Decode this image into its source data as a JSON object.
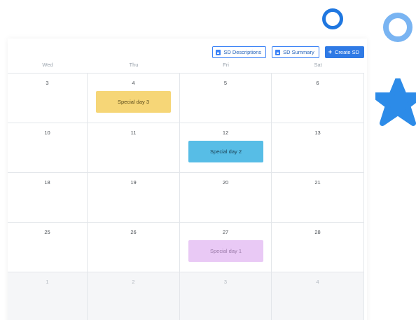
{
  "toolbar": {
    "descriptions_label": "SD Descriptions",
    "summary_label": "SD Summary",
    "create_label": "Create SD",
    "accent_color": "#2f7ae5"
  },
  "day_headers": [
    "Wed",
    "Thu",
    "Fri",
    "Sat"
  ],
  "weeks": [
    [
      {
        "day": "3"
      },
      {
        "day": "4",
        "event": {
          "title": "Special day 3",
          "color": "#f6d677",
          "text_color": "#5a4a1a"
        }
      },
      {
        "day": "5"
      },
      {
        "day": "6"
      }
    ],
    [
      {
        "day": "10"
      },
      {
        "day": "11"
      },
      {
        "day": "12",
        "event": {
          "title": "Special day 2",
          "color": "#57bde6",
          "text_color": "#1b3f52"
        }
      },
      {
        "day": "13"
      }
    ],
    [
      {
        "day": "18"
      },
      {
        "day": "19"
      },
      {
        "day": "20"
      },
      {
        "day": "21"
      }
    ],
    [
      {
        "day": "25"
      },
      {
        "day": "26"
      },
      {
        "day": "27",
        "event": {
          "title": "Special day 1",
          "color": "#e9c9f5",
          "text_color": "#9a7aa8"
        }
      },
      {
        "day": "28"
      }
    ],
    [
      {
        "day": "1",
        "outside_month": true
      },
      {
        "day": "2",
        "outside_month": true
      },
      {
        "day": "3",
        "outside_month": true
      },
      {
        "day": "4",
        "outside_month": true
      }
    ]
  ],
  "icons": {
    "descriptions": "document-icon",
    "summary": "document-icon",
    "create": "plus-icon"
  }
}
